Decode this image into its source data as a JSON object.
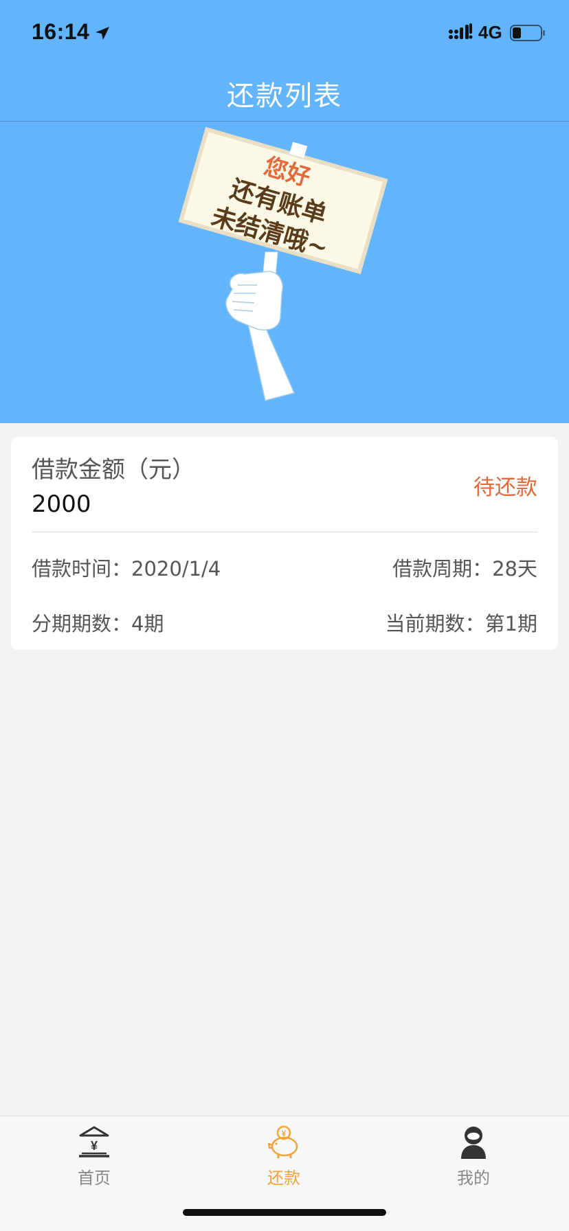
{
  "status_bar": {
    "time": "16:14",
    "network": "4G",
    "icons": [
      "location-arrow-icon",
      "signal-icon",
      "battery-icon"
    ]
  },
  "nav": {
    "title": "还款列表"
  },
  "banner": {
    "sign_line1": "您好",
    "sign_line2": "还有账单",
    "sign_line3": "未结清哦~"
  },
  "loan": {
    "amount_label": "借款金额（元）",
    "amount": "2000",
    "status": "待还款",
    "loan_time_label": "借款时间：",
    "loan_time": "2020/1/4",
    "loan_period_label": "借款周期：",
    "loan_period": "28天",
    "installments_label": "分期期数：",
    "installments": "4期",
    "current_label": "当前期数：",
    "current": "第1期"
  },
  "tabbar": {
    "items": [
      {
        "label": "首页",
        "icon": "bank-icon",
        "active": false
      },
      {
        "label": "还款",
        "icon": "piggy-bank-icon",
        "active": true
      },
      {
        "label": "我的",
        "icon": "user-icon",
        "active": false
      }
    ]
  },
  "colors": {
    "primary": "#62b4fc",
    "accent": "#f2a33a",
    "status": "#e06a3b"
  }
}
